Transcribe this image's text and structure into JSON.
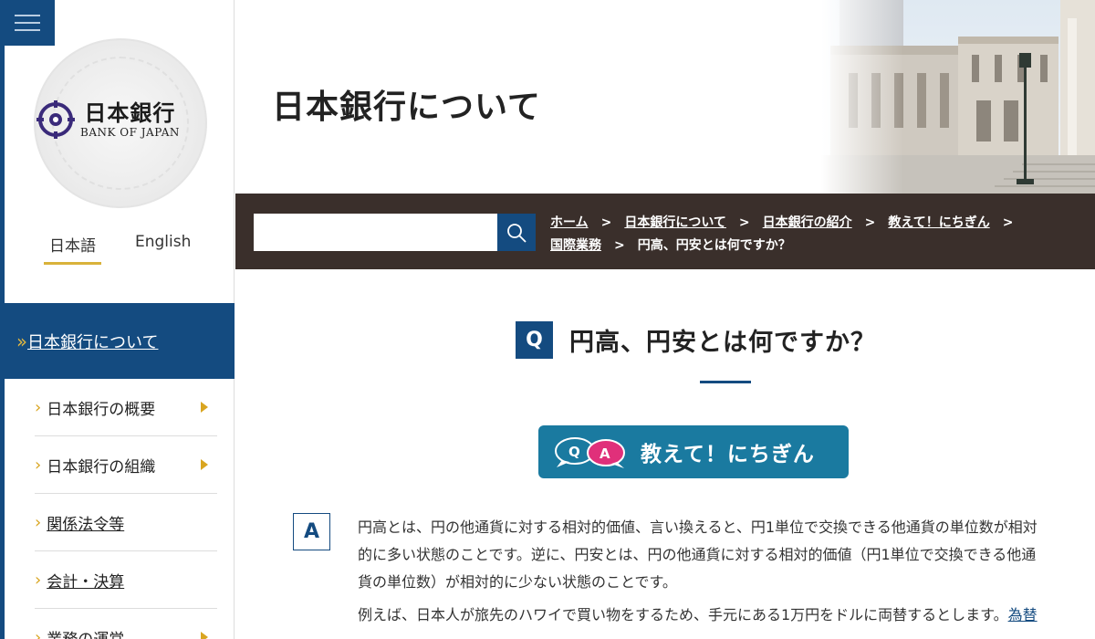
{
  "sidebar": {
    "logo": {
      "jp": "日本銀行",
      "en": "BANK OF JAPAN"
    },
    "lang": {
      "ja": "日本語",
      "en": "English"
    },
    "active_item": "日本銀行について",
    "items": [
      {
        "label": "日本銀行の概要"
      },
      {
        "label": "日本銀行の組織"
      },
      {
        "label": "関係法令等"
      },
      {
        "label": "会計・決算"
      },
      {
        "label": "業務の運営"
      }
    ]
  },
  "header": {
    "title": "日本銀行について"
  },
  "breadcrumb": {
    "items": [
      "ホーム",
      "日本銀行について",
      "日本銀行の紹介",
      "教えて！にちぎん",
      "国際業務"
    ],
    "current": "円高、円安とは何ですか？",
    "separator": ">"
  },
  "main": {
    "q_badge": "Q",
    "question": "円高、円安とは何ですか？",
    "banner": {
      "q": "Q",
      "a": "A",
      "label": "教えて！にちぎん"
    },
    "a_badge": "A",
    "answer_lines": [
      "円高とは、円の他通貨に対する相対的価値、言い換えると、円1単位で交換できる他通貨の単位数が相対",
      "的に多い状態のことです。逆に、円安とは、円の他通貨に対する相対的価値（円1単位で交換できる他通",
      "貨の単位数）が相対的に少ない状態のことです。"
    ],
    "example": "例えば、日本人が旅先のハワイで買い物をするため、手元にある1万円をドルに両替するとします。",
    "example_link": "為替"
  },
  "colors": {
    "navy": "#144b80",
    "gold": "#d9a520",
    "crumbbar": "#3a2f2b",
    "teal": "#1a7aa0",
    "pink": "#e0307a"
  }
}
